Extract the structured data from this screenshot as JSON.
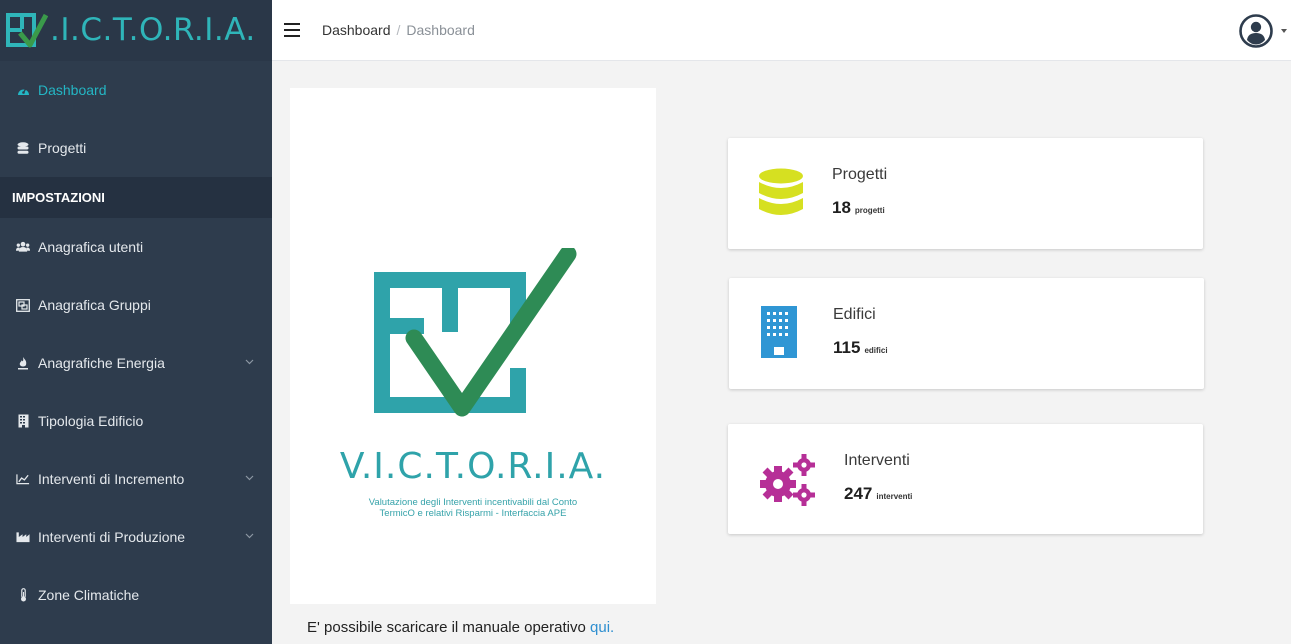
{
  "brand": {
    "name": ".I.C.T.O.R.I.A."
  },
  "breadcrumb": {
    "root": "Dashboard",
    "separator": "/",
    "current": "Dashboard"
  },
  "sidebar": {
    "items": [
      {
        "label": "Dashboard",
        "icon": "tachometer-icon",
        "active": true
      },
      {
        "label": "Progetti",
        "icon": "database-icon"
      }
    ],
    "section_title": "IMPOSTAZIONI",
    "settings": [
      {
        "label": "Anagrafica utenti",
        "icon": "users-icon"
      },
      {
        "label": "Anagrafica Gruppi",
        "icon": "object-group-icon"
      },
      {
        "label": "Anagrafiche Energia",
        "icon": "fire-icon",
        "submenu": true
      },
      {
        "label": "Tipologia Edificio",
        "icon": "building-icon"
      },
      {
        "label": "Interventi di Incremento",
        "icon": "line-chart-icon",
        "submenu": true
      },
      {
        "label": "Interventi di Produzione",
        "icon": "industry-icon",
        "submenu": true
      },
      {
        "label": "Zone Climatiche",
        "icon": "thermometer-icon"
      }
    ]
  },
  "logo_panel": {
    "title": "V.I.C.T.O.R.I.A.",
    "subtitle_line1": "Valutazione degli Interventi incentivabili dal Conto",
    "subtitle_line2": "TermicO e relativi Risparmi - Interfaccia APE"
  },
  "stats": [
    {
      "title": "Progetti",
      "value": "18",
      "unit": "progetti",
      "icon": "database-icon",
      "color": "#d6e021"
    },
    {
      "title": "Edifici",
      "value": "115",
      "unit": "edifici",
      "icon": "building-icon",
      "color": "#2f96d4"
    },
    {
      "title": "Interventi",
      "value": "247",
      "unit": "interventi",
      "icon": "cogs-icon",
      "color": "#b62f97"
    }
  ],
  "footer": {
    "text": "E' possibile scaricare il manuale operativo ",
    "link": "qui."
  },
  "colors": {
    "sidebar": "#2e3c4d",
    "accent": "#24b6c4",
    "brand_teal": "#2fa3aa"
  }
}
